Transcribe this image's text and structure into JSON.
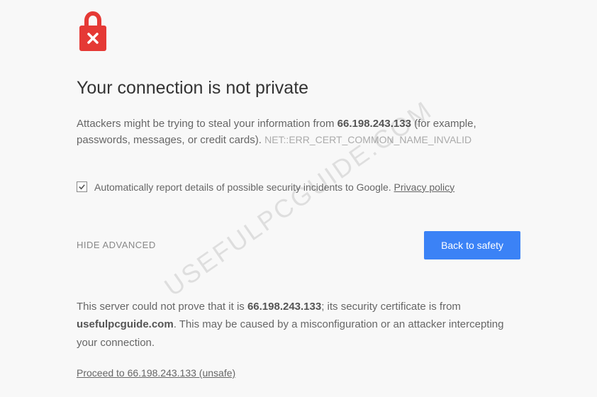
{
  "heading": "Your connection is not private",
  "description": {
    "prefix": "Attackers might be trying to steal your information from ",
    "ip": "66.198.243.133",
    "suffix": " (for example, passwords, messages, or credit cards). ",
    "error_code": "NET::ERR_CERT_COMMON_NAME_INVALID"
  },
  "checkbox": {
    "checked": true,
    "label": "Automatically report details of possible security incidents to Google. ",
    "privacy_link": "Privacy policy"
  },
  "actions": {
    "hide_advanced": "HIDE ADVANCED",
    "back_to_safety": "Back to safety"
  },
  "advanced": {
    "part1": "This server could not prove that it is ",
    "ip": "66.198.243.133",
    "part2": "; its security certificate is from ",
    "domain": "usefulpcguide.com",
    "part3": ". This may be caused by a misconfiguration or an attacker intercepting your connection."
  },
  "proceed_link": "Proceed to 66.198.243.133 (unsafe)",
  "watermark": "USEFULPCGUIDE.COM"
}
